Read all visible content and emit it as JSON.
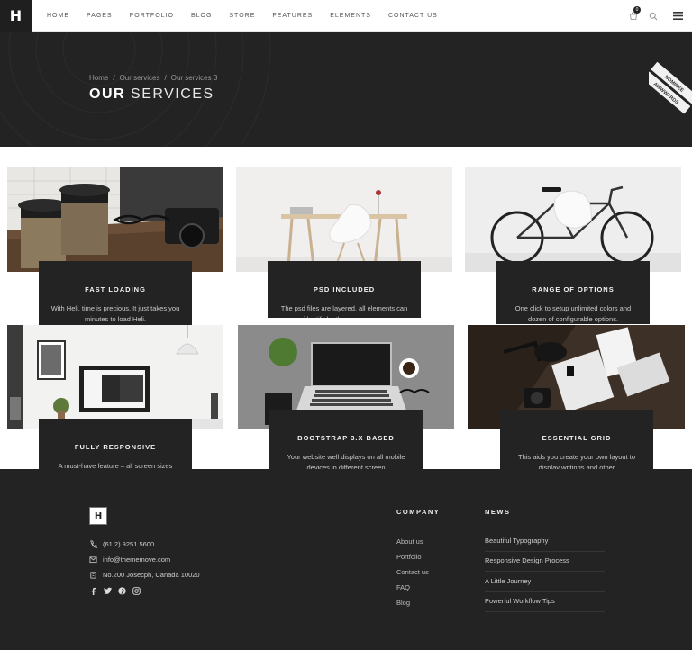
{
  "header": {
    "logo": "H",
    "nav": [
      "HOME",
      "PAGES",
      "PORTFOLIO",
      "BLOG",
      "STORE",
      "FEATURES",
      "ELEMENTS",
      "CONTACT US"
    ],
    "cart_count": "0",
    "icons": [
      "cart-icon",
      "search-icon",
      "menu-icon"
    ]
  },
  "hero": {
    "breadcrumb": [
      "Home",
      "Our services",
      "Our services 3"
    ],
    "breadcrumb_separator": "/",
    "title_bold": "OUR",
    "title_light": "SERVICES",
    "ribbon_lines": [
      "NOMINEE",
      "AWWWARDS"
    ]
  },
  "services": [
    {
      "title": "FAST LOADING",
      "desc": "With Heli, time is precious. It just takes you minutes to load Heli."
    },
    {
      "title": "PSD INCLUDED",
      "desc": "The psd files are layered, all elements can identify by the group name."
    },
    {
      "title": "RANGE OF OPTIONS",
      "desc": "One click to setup unlimited colors and dozen of configurable options."
    },
    {
      "title": "FULLY RESPONSIVE",
      "desc": "A must-have feature  – all screen sizes"
    },
    {
      "title": "BOOTSTRAP 3.X BASED",
      "desc": "Your website well displays on all mobile devices in different screen"
    },
    {
      "title": "ESSENTIAL GRID",
      "desc": "This aids you create your own layout to display writings and other"
    }
  ],
  "footer": {
    "logo": "H",
    "phone": "(61 2) 9251 5600",
    "email": "info@thememove.com",
    "address": "No.200 Josecph, Canada 10020",
    "social_icons": [
      "facebook-icon",
      "twitter-icon",
      "pinterest-icon",
      "instagram-icon"
    ],
    "company_title": "COMPANY",
    "company_links": [
      "About us",
      "Portfolio",
      "Contact us",
      "FAQ",
      "Blog"
    ],
    "news_title": "NEWS",
    "news_items": [
      "Beautiful Typography",
      "Responsive Design Process",
      "A Little Journey",
      "Powerful Workflow Tips"
    ]
  },
  "colors": {
    "dark": "#232323",
    "header_bg": "#ffffff",
    "text_light": "#cfcfcf"
  }
}
